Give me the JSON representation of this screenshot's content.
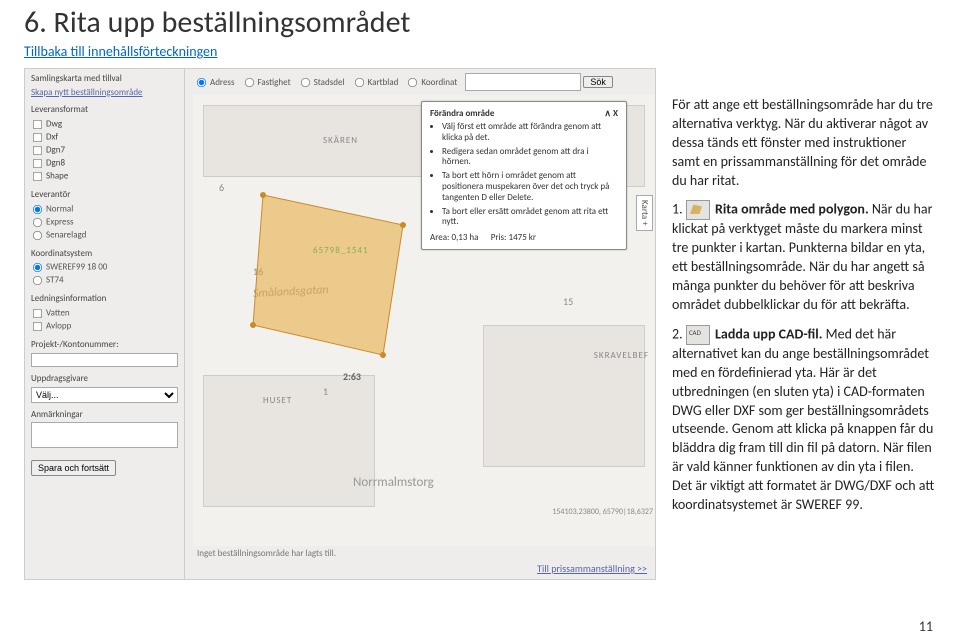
{
  "heading": "6. Rita upp beställningsområdet",
  "toc_link": "Tillbaka till innehållsförteckningen",
  "intro": "För att ange ett beställningsområde har du tre alternativa verktyg. När du aktiverar något av dessa tänds ett fönster med instruktioner samt en prissammanställning för det område du har ritat.",
  "step1_num": "1.",
  "step1_title": "Rita område med polygon.",
  "step1_body": "När du har klickat på verktyget måste du markera minst tre punkter i kartan. Punkterna bildar en yta, ett beställningsområde. När du har angett så många punkter du behöver för att beskriva området dubbelklickar du för att bekräfta.",
  "step2_num": "2.",
  "step2_title": "Ladda upp CAD-fil.",
  "step2_body": "Med det här alternativet kan du ange beställningsområdet med en fördefinierad yta. Här är det utbredningen (en sluten yta) i CAD-formaten DWG eller DXF som ger beställningsområdets utseende. Genom att klicka på knappen får du bläddra dig fram till din fil på datorn. När filen är vald känner funktionen av din yta i filen. Det är viktigt att formatet är DWG/DXF och att koordinatsystemet är SWEREF 99.",
  "page_number": "11",
  "ui": {
    "side": {
      "title": "Samlingskarta med tillval",
      "link": "Skapa nytt beställningsområde",
      "format_title": "Leveransformat",
      "formats": [
        "Dwg",
        "Dxf",
        "Dgn7",
        "Dgn8",
        "Shape"
      ],
      "leverantor_title": "Leverantör",
      "leverantor": [
        "Normal",
        "Express",
        "Senarelagd"
      ],
      "koord_title": "Koordinatsystem",
      "koord": [
        "SWEREF99 18 00",
        "ST74"
      ],
      "ledning_title": "Ledningsinformation",
      "ledning": [
        "Vatten",
        "Avlopp"
      ],
      "projekt_title": "Projekt-/Kontonummer:",
      "uppdrag_title": "Uppdragsgivare",
      "uppdrag_placeholder": "Välj...",
      "anmark_title": "Anmärkningar",
      "save_btn": "Spara och fortsätt"
    },
    "top": {
      "opts": [
        "Adress",
        "Fastighet",
        "Stadsdel",
        "Kartblad",
        "Koordinat"
      ],
      "search_btn": "Sök"
    },
    "overlay": {
      "title": "Förändra område",
      "close": "∧ X",
      "bullets": [
        "Välj först ett område att förändra genom att klicka på det.",
        "Redigera sedan området genom att dra i hörnen.",
        "Ta bort ett hörn i området genom att positionera muspekaren över det och tryck på tangenten D eller Delete.",
        "Ta bort eller ersätt området genom att rita ett nytt."
      ],
      "area_label": "Area: 0,13 ha",
      "price_label": "Pris: 1475 kr"
    },
    "map": {
      "karta_tab": "Karta +",
      "labels": {
        "skaren": "SKÄREN",
        "skravelber": "SKRAVELBEF",
        "huset": "HUSET",
        "street": "Smålandsgatan",
        "norrmalm": "Norrmalmstorg",
        "parcel": "65798_1541",
        "ratio": "2:63",
        "n6": "6",
        "n16": "16",
        "n1": "1",
        "n15": "15"
      },
      "coord": "154103,23800, 65790|18,6327",
      "status": "Inget beställningsområde har lagts till."
    },
    "footer_link": "Till prissammanställning >>"
  }
}
